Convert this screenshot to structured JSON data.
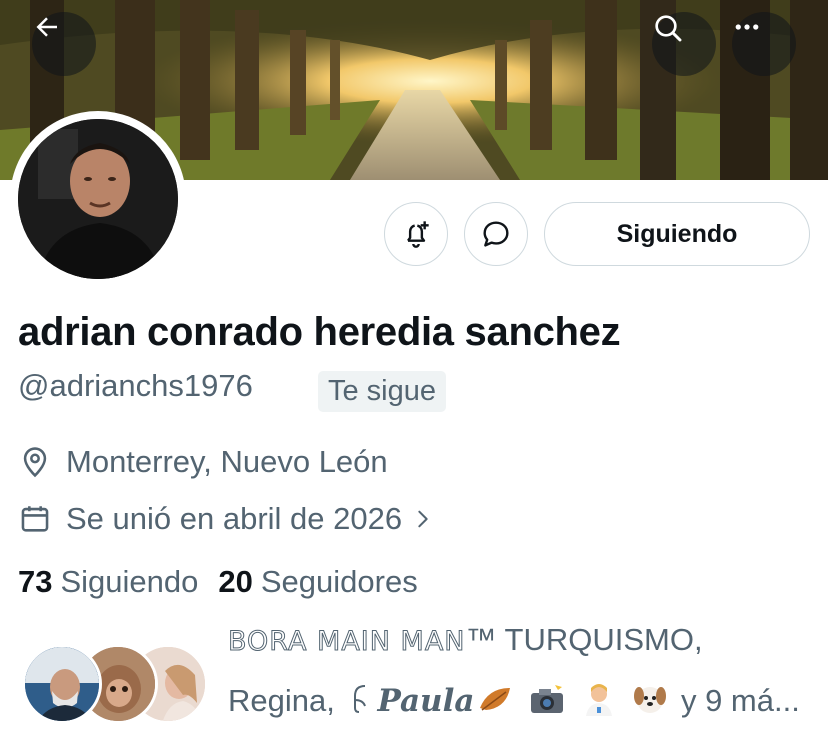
{
  "header": {
    "back_icon": "arrow-left-icon",
    "search_icon": "search-icon",
    "more_icon": "more-horizontal-icon"
  },
  "profile": {
    "display_name": "adrian conrado heredia sanchez",
    "handle": "@adrianchs1976",
    "follows_you_badge": "Te sigue",
    "location": "Monterrey, Nuevo León",
    "joined": "Se unió en abril de 2026"
  },
  "actions": {
    "notify_icon": "bell-plus-icon",
    "message_icon": "message-bubble-icon",
    "following_label": "Siguiendo"
  },
  "stats": {
    "following_count": "73",
    "following_label": "Siguiendo",
    "followers_count": "20",
    "followers_label": "Seguidores"
  },
  "followed_by": {
    "line1_outline": "BORA MAIN MAN",
    "line1_rest": "™ TURQUISMO,",
    "line2_prefix": "Regina,",
    "line2_paula_glyph": "𝅘",
    "line2_paula": "Paula",
    "line2_suffix": "y 9 má..."
  },
  "colors": {
    "text_primary": "#0f1419",
    "text_secondary": "#536471",
    "border": "#cfd9de",
    "badge_bg": "#eff3f4"
  }
}
